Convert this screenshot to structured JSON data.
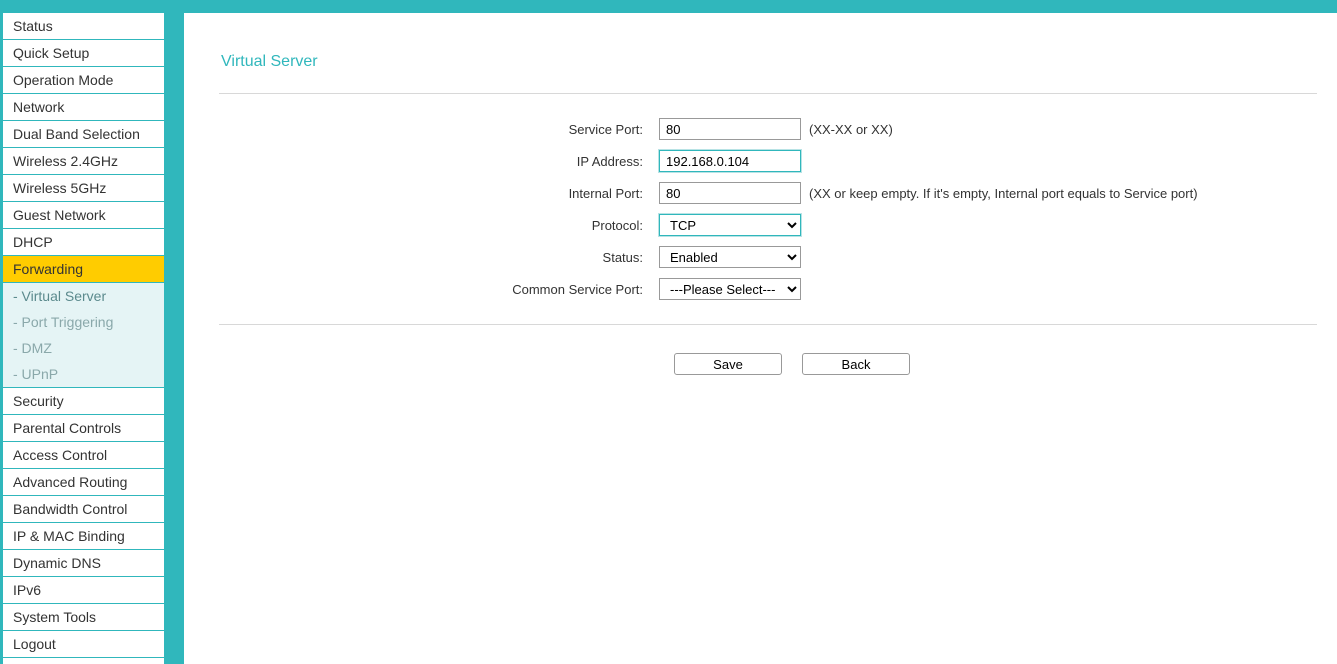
{
  "sidebar": {
    "items": [
      {
        "label": "Status",
        "name": "sidebar-item-status"
      },
      {
        "label": "Quick Setup",
        "name": "sidebar-item-quick-setup"
      },
      {
        "label": "Operation Mode",
        "name": "sidebar-item-operation-mode"
      },
      {
        "label": "Network",
        "name": "sidebar-item-network"
      },
      {
        "label": "Dual Band Selection",
        "name": "sidebar-item-dual-band-selection"
      },
      {
        "label": "Wireless 2.4GHz",
        "name": "sidebar-item-wireless-24ghz"
      },
      {
        "label": "Wireless 5GHz",
        "name": "sidebar-item-wireless-5ghz"
      },
      {
        "label": "Guest Network",
        "name": "sidebar-item-guest-network"
      },
      {
        "label": "DHCP",
        "name": "sidebar-item-dhcp"
      },
      {
        "label": "Forwarding",
        "name": "sidebar-item-forwarding",
        "active": true
      },
      {
        "label": "Security",
        "name": "sidebar-item-security"
      },
      {
        "label": "Parental Controls",
        "name": "sidebar-item-parental-controls"
      },
      {
        "label": "Access Control",
        "name": "sidebar-item-access-control"
      },
      {
        "label": "Advanced Routing",
        "name": "sidebar-item-advanced-routing"
      },
      {
        "label": "Bandwidth Control",
        "name": "sidebar-item-bandwidth-control"
      },
      {
        "label": "IP & MAC Binding",
        "name": "sidebar-item-ip-mac-binding"
      },
      {
        "label": "Dynamic DNS",
        "name": "sidebar-item-dynamic-dns"
      },
      {
        "label": "IPv6",
        "name": "sidebar-item-ipv6"
      },
      {
        "label": "System Tools",
        "name": "sidebar-item-system-tools"
      },
      {
        "label": "Logout",
        "name": "sidebar-item-logout"
      }
    ],
    "sub": [
      {
        "label": "- Virtual Server",
        "name": "sidebar-sub-virtual-server",
        "active": true
      },
      {
        "label": "- Port Triggering",
        "name": "sidebar-sub-port-triggering"
      },
      {
        "label": "- DMZ",
        "name": "sidebar-sub-dmz"
      },
      {
        "label": "- UPnP",
        "name": "sidebar-sub-upnp"
      }
    ]
  },
  "page": {
    "title": "Virtual Server"
  },
  "form": {
    "service_port": {
      "label": "Service Port:",
      "value": "80",
      "hint": "(XX-XX or XX)"
    },
    "ip_address": {
      "label": "IP Address:",
      "value": "192.168.0.104"
    },
    "internal_port": {
      "label": "Internal Port:",
      "value": "80",
      "hint": "(XX or keep empty. If it's empty, Internal port equals to Service port)"
    },
    "protocol": {
      "label": "Protocol:",
      "value": "TCP"
    },
    "status": {
      "label": "Status:",
      "value": "Enabled"
    },
    "common_service_port": {
      "label": "Common Service Port:",
      "value": "---Please Select---"
    }
  },
  "buttons": {
    "save": "Save",
    "back": "Back"
  }
}
